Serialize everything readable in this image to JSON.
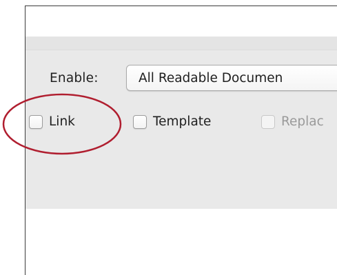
{
  "options": {
    "enable_label": "Enable:",
    "enable_select_value": "All Readable Documen",
    "checkboxes": [
      {
        "label": "Link",
        "checked": false,
        "enabled": true
      },
      {
        "label": "Template",
        "checked": false,
        "enabled": true
      },
      {
        "label": "Replac",
        "checked": false,
        "enabled": false
      }
    ]
  },
  "annotation": {
    "highlight_color": "#b01e2f"
  },
  "colors": {
    "panel_background": "#e9e9e9",
    "window_border": "#3a3a3a"
  }
}
